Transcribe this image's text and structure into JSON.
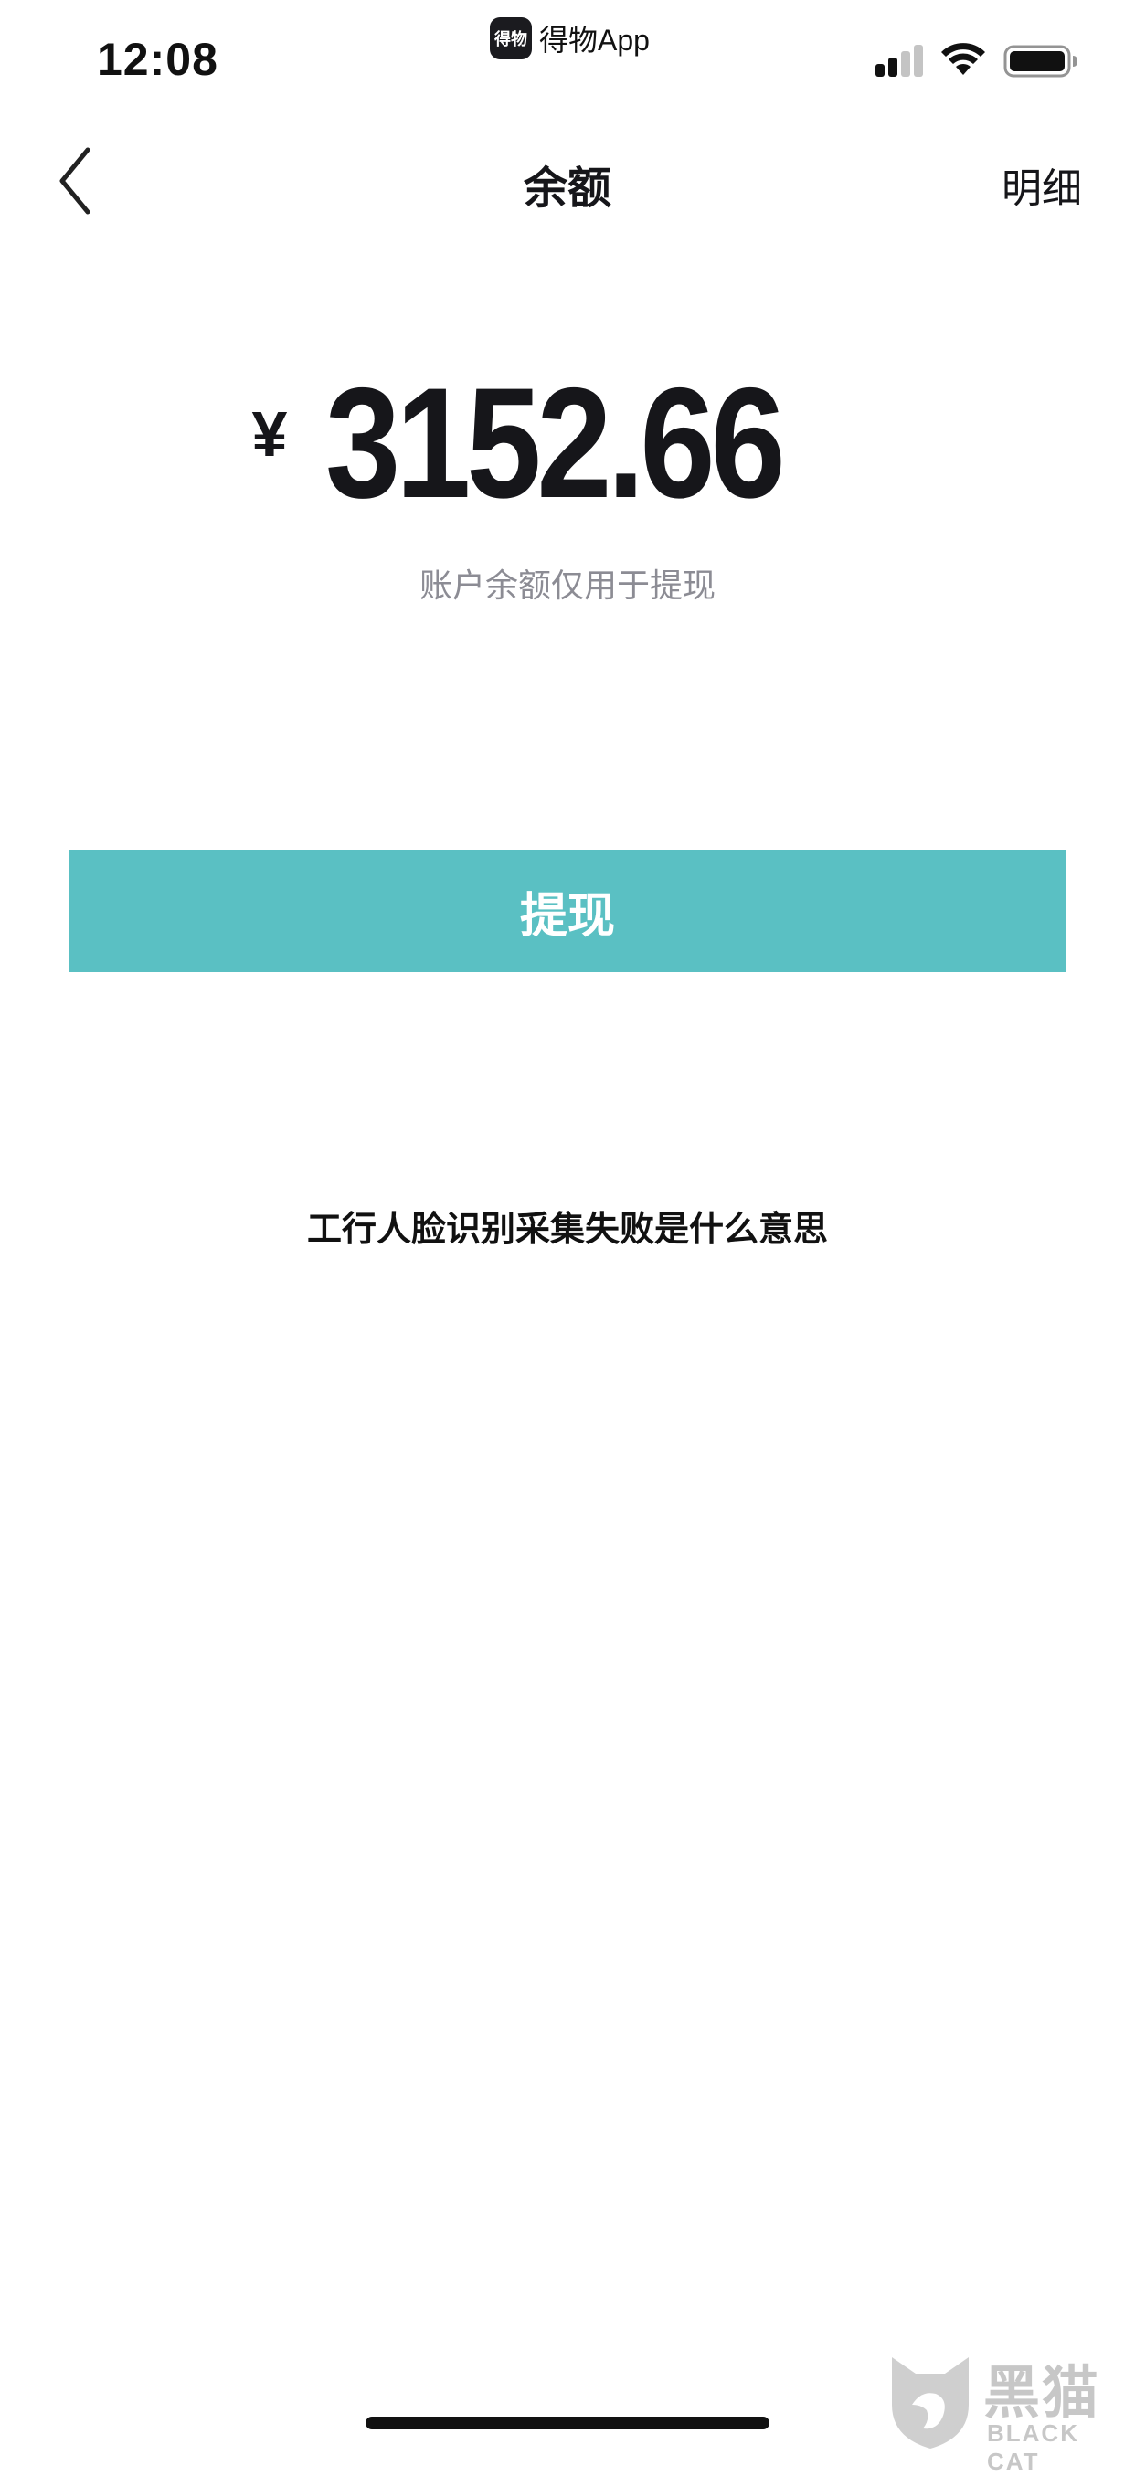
{
  "status_bar": {
    "time": "12:08",
    "app_logo_text": "得物",
    "app_name": "得物App"
  },
  "nav": {
    "title": "余额",
    "detail_label": "明细"
  },
  "balance": {
    "currency": "¥",
    "amount": "3152.66",
    "note": "账户余额仅用于提现"
  },
  "actions": {
    "withdraw_label": "提现"
  },
  "caption": "工行人脸识别采集失败是什么意思",
  "watermark": {
    "cn": "黑猫",
    "en": "BLACK CAT"
  },
  "colors": {
    "accent": "#5ac0c3",
    "text": "#16161a",
    "muted": "#8c8c94"
  }
}
